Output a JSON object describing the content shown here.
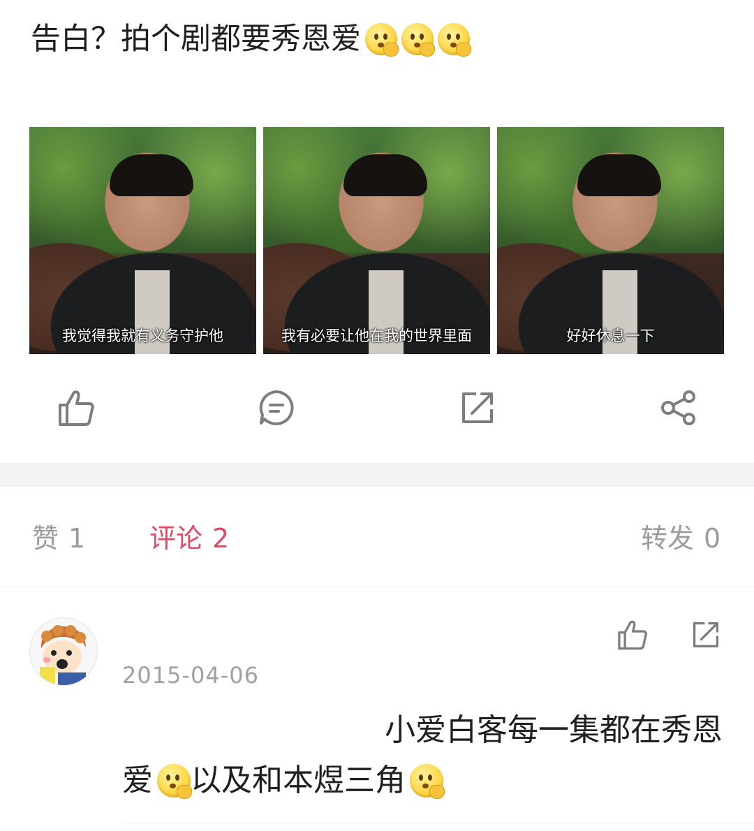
{
  "post": {
    "text": "告白？拍个剧都要秀恩爱",
    "emoji_icon": "thinking-face-emoji"
  },
  "images": [
    {
      "caption": "我觉得我就有义务守护他"
    },
    {
      "caption": "我有必要让他在我的世界里面"
    },
    {
      "caption": "好好休息一下"
    }
  ],
  "actions": {
    "like_icon": "thumbs-up-icon",
    "comment_icon": "comment-bubble-icon",
    "repost_icon": "external-share-icon",
    "share_icon": "share-nodes-icon"
  },
  "tabs": [
    {
      "label": "赞",
      "count": "1"
    },
    {
      "label": "评论",
      "count": "2",
      "active": true
    },
    {
      "label": "转发",
      "count": "0"
    }
  ],
  "colors": {
    "accent": "#e04a62",
    "muted": "#9b9b9b",
    "separator": "#f2f2f2"
  },
  "comment": {
    "date": "2015-04-06",
    "line1": "小爱白客每一集都在秀恩",
    "line2_part1": "爱",
    "line2_part2": "以及和本煜三角"
  }
}
